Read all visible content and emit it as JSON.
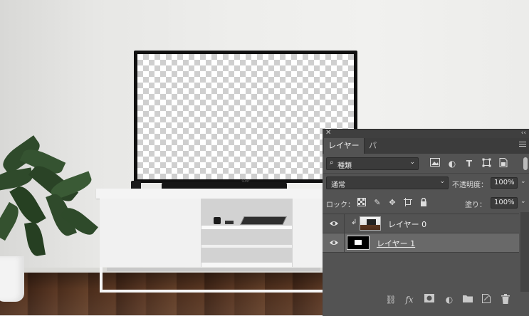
{
  "panel": {
    "tabs": [
      {
        "label": "レイヤー",
        "active": true
      },
      {
        "label": "パス",
        "active": false
      }
    ],
    "filter": {
      "value": "種類",
      "icons": [
        "image-filter-icon",
        "adjustment-filter-icon",
        "type-filter-icon",
        "shape-filter-icon",
        "smart-object-filter-icon"
      ]
    },
    "blend_mode": "通常",
    "opacity_label": "不透明度：",
    "opacity_value": "100%",
    "lock_label": "ロック：",
    "fill_label": "塗り：",
    "fill_value": "100%",
    "layers": [
      {
        "name": "レイヤー 0",
        "visible": true,
        "clipped": true,
        "selected": false
      },
      {
        "name": "レイヤー 1",
        "visible": true,
        "clipped": false,
        "selected": true
      }
    ],
    "footer_icons": [
      "link-layers-icon",
      "fx-icon",
      "add-mask-icon",
      "adjustment-layer-icon",
      "new-group-icon",
      "new-layer-icon",
      "trash-icon"
    ],
    "fx_label": "fx"
  },
  "canvas": {
    "tv_brand": "SONY"
  },
  "colors": {
    "panel_bg": "#535353",
    "tab_bar": "#3c3c3c",
    "selected_layer": "#696969"
  }
}
